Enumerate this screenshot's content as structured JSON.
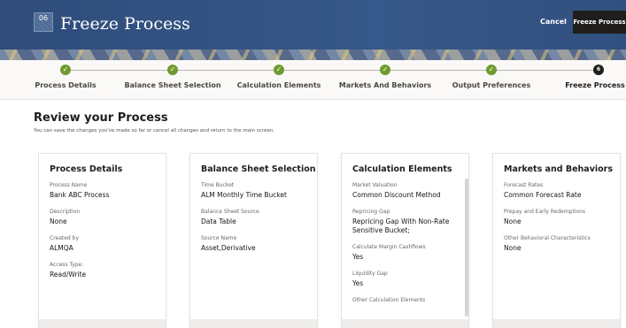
{
  "header": {
    "step_number": "06",
    "title": "Freeze Process",
    "cancel_label": "Cancel",
    "freeze_label": "Freeze Process"
  },
  "train": {
    "steps": [
      {
        "label": "Process Details",
        "status": "complete"
      },
      {
        "label": "Balance Sheet Selection",
        "status": "complete"
      },
      {
        "label": "Calculation Elements",
        "status": "complete"
      },
      {
        "label": "Markets And Behaviors",
        "status": "complete"
      },
      {
        "label": "Output Preferences",
        "status": "complete"
      },
      {
        "label": "Freeze Process",
        "status": "current",
        "number": "6"
      }
    ],
    "check_glyph": "✓"
  },
  "review": {
    "title": "Review your Process",
    "subtitle": "You can save the changes you've made so far or cancel all changes and return to the main screen."
  },
  "cards": [
    {
      "title": "Process Details",
      "fields": [
        {
          "label": "Process Name",
          "value": "Bank ABC Process"
        },
        {
          "label": "Description",
          "value": "None"
        },
        {
          "label": "Created by",
          "value": "ALMQA"
        },
        {
          "label": "Access Type:",
          "value": "Read/Write"
        }
      ]
    },
    {
      "title": "Balance Sheet Selection",
      "fields": [
        {
          "label": "Time Bucket",
          "value": "ALM Monthly Time Bucket"
        },
        {
          "label": "Balance Sheet Source",
          "value": "Data Table"
        },
        {
          "label": "Source Name",
          "value": "Asset,Derivative"
        }
      ]
    },
    {
      "title": "Calculation Elements",
      "fields": [
        {
          "label": "Market Valuation",
          "value": "Common Discount Method"
        },
        {
          "label": "Repricing Gap",
          "value": "Repricing Gap With Non-Rate Sensitive Bucket;"
        },
        {
          "label": "Calculate Margin Cashflows",
          "value": "Yes"
        },
        {
          "label": "Liquidity Gap",
          "value": "Yes"
        },
        {
          "label": "Other Calculation Elements",
          "value": ""
        }
      ]
    },
    {
      "title": "Markets and Behaviors",
      "fields": [
        {
          "label": "Forecast Rates",
          "value": "Common Forecast Rate"
        },
        {
          "label": "Prepay and Early Redemptions",
          "value": "None"
        },
        {
          "label": "Other Behavioral Characteristics",
          "value": "None"
        }
      ]
    }
  ]
}
